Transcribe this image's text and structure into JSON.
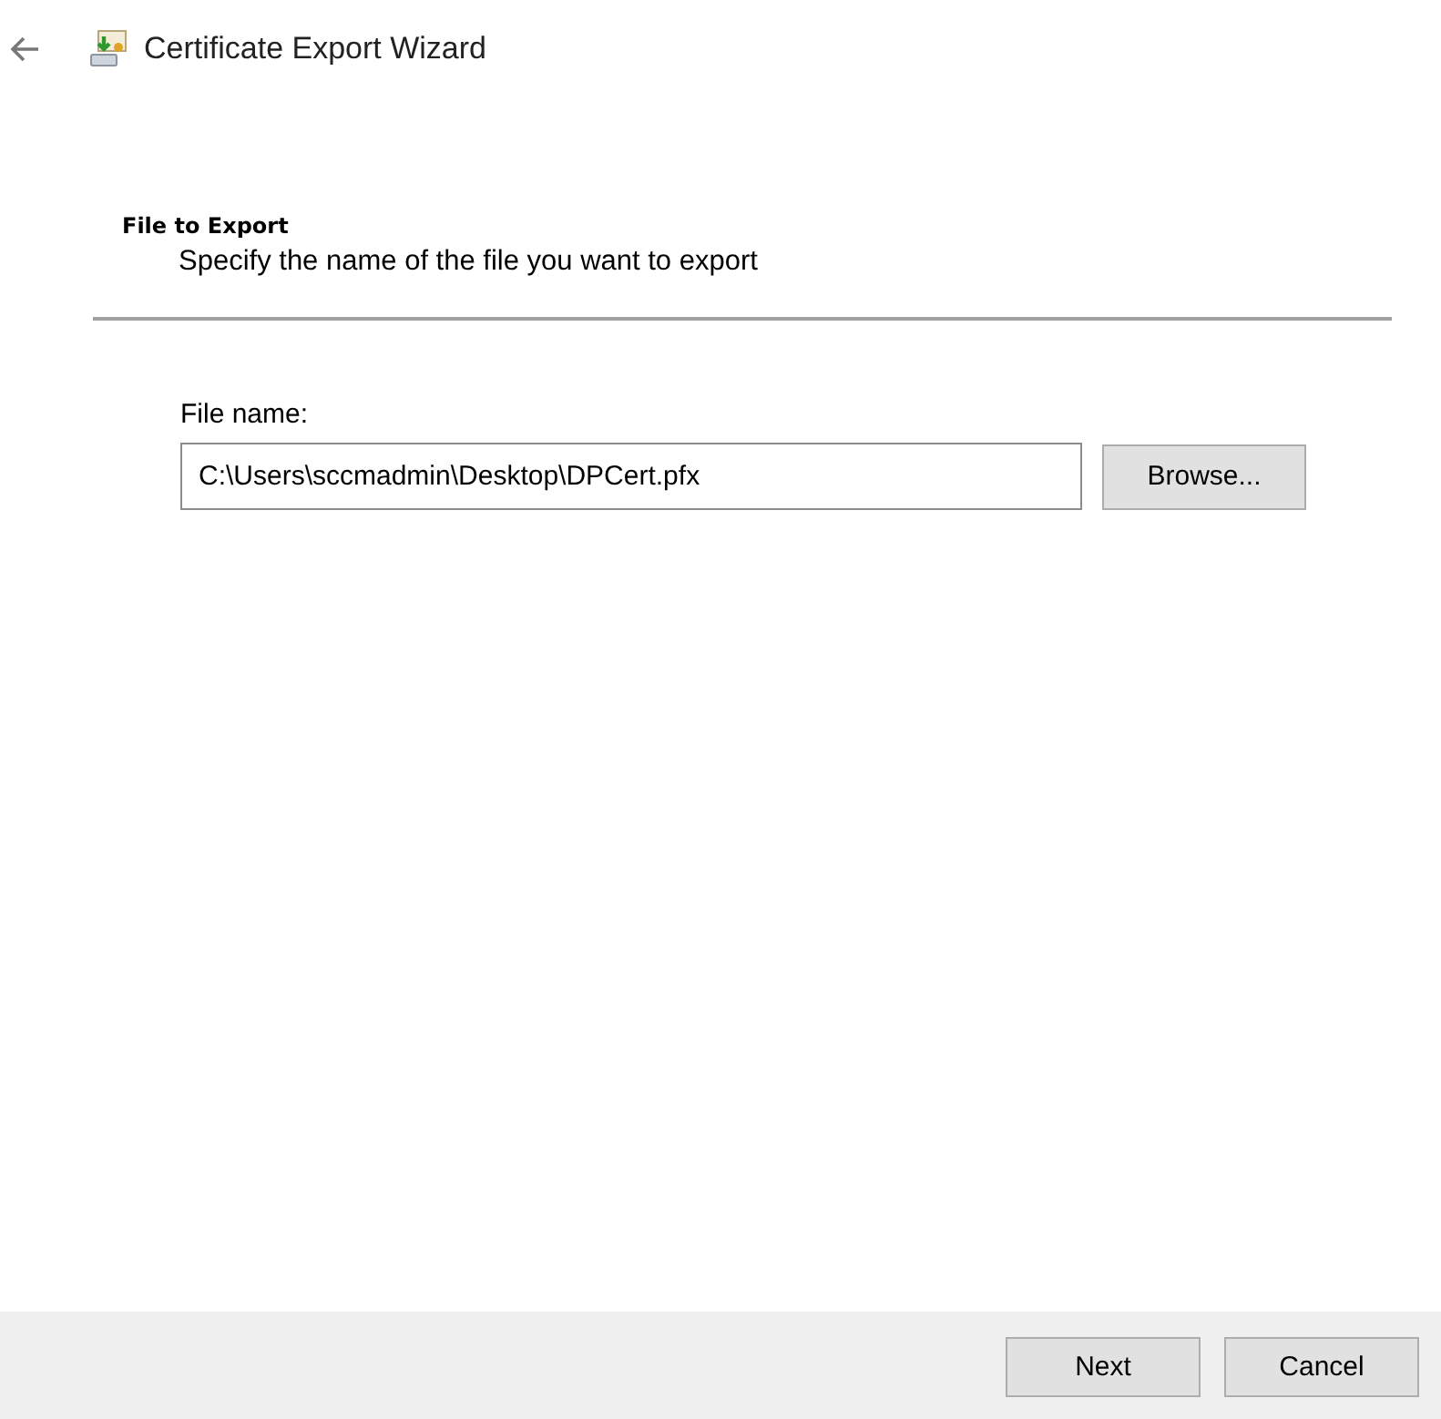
{
  "window": {
    "title": "Certificate Export Wizard"
  },
  "header": {
    "title": "File to Export",
    "subtitle": "Specify the name of the file you want to export"
  },
  "file_name": {
    "label": "File name:",
    "value": "C:\\Users\\sccmadmin\\Desktop\\DPCert.pfx"
  },
  "browse_button": "Browse...",
  "buttons": [
    "Next",
    "Cancel"
  ]
}
